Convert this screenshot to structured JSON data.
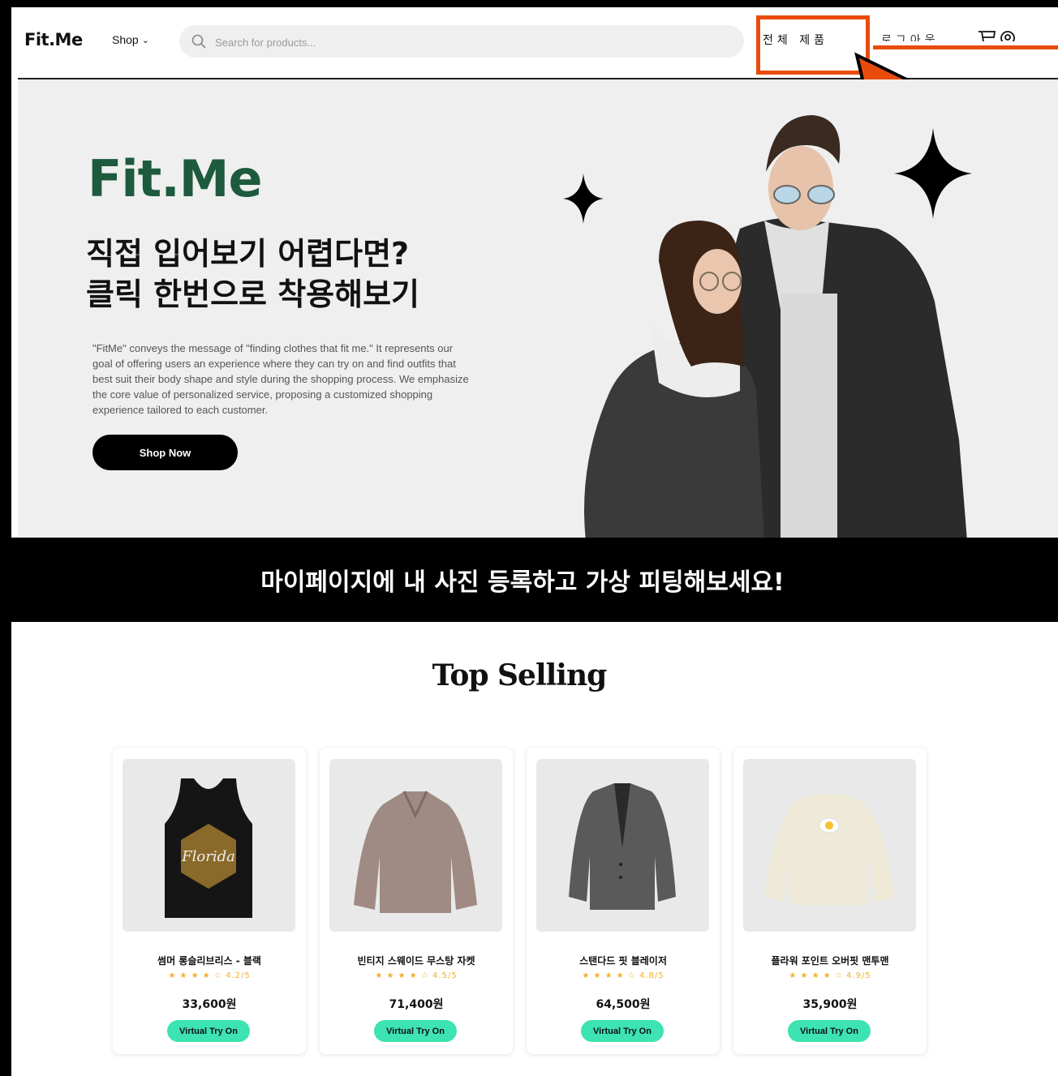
{
  "header": {
    "logo": "Fit.Me",
    "shop_label": "Shop",
    "search_placeholder": "Search for products...",
    "nav_all_products": "전체 제품",
    "nav_login": "로그아웃"
  },
  "hero": {
    "brand": "Fit.Me",
    "headline_line1": "직접 입어보기 어렵다면?",
    "headline_line2": "클릭 한번으로 착용해보기",
    "description": "\"FitMe\" conveys the message of \"finding clothes that fit me.\" It represents our goal of offering users an experience where they can try on and find outfits that best suit their body shape and style during the shopping process. We emphasize the core value of personalized service, proposing a customized shopping experience tailored to each customer.",
    "cta_label": "Shop Now"
  },
  "banner": {
    "text": "마이페이지에 내 사진 등록하고 가상 피팅해보세요!"
  },
  "top_selling": {
    "title": "Top Selling",
    "products": [
      {
        "name": "썸머 롱슬리브리스 - 블랙",
        "stars": "★ ★ ★ ★ ☆",
        "rating": "4.2/5",
        "price": "33,600원",
        "button": "Virtual Try On"
      },
      {
        "name": "빈티지 스웨이드 무스탕 자켓",
        "stars": "★ ★ ★ ★ ☆",
        "rating": "4.5/5",
        "price": "71,400원",
        "button": "Virtual Try On"
      },
      {
        "name": "스탠다드 핏 블레이저",
        "stars": "★ ★ ★ ★ ☆",
        "rating": "4.8/5",
        "price": "64,500원",
        "button": "Virtual Try On"
      },
      {
        "name": "플라워 포인트 오버핏 맨투맨",
        "stars": "★ ★ ★ ★ ☆",
        "rating": "4.9/5",
        "price": "35,900원",
        "button": "Virtual Try On"
      }
    ]
  },
  "colors": {
    "brand_green": "#1e5a3d",
    "accent_mint": "#3de3b2",
    "highlight_orange": "#e84c0c",
    "star_gold": "#f2b02a"
  },
  "icons": [
    "search-icon",
    "chevron-down-icon",
    "cart-icon",
    "user-icon",
    "sparkle-icon",
    "cursor-arrow-icon"
  ]
}
